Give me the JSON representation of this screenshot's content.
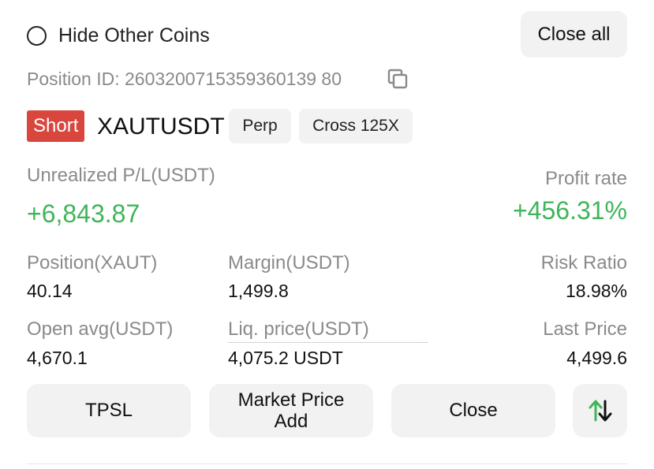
{
  "header": {
    "hide_other_coins_label": "Hide Other Coins",
    "close_all_label": "Close all"
  },
  "position": {
    "id_text": "Position ID: 2603200715359360139 80",
    "side": "Short",
    "symbol": "XAUTUSDT",
    "type_chip": "Perp",
    "margin_chip": "Cross 125X"
  },
  "pnl": {
    "unrealized_label": "Unrealized P/L(USDT)",
    "unrealized_value": "+6,843.87",
    "profit_rate_label": "Profit rate",
    "profit_rate_value": "+456.31%"
  },
  "stats": {
    "position_label": "Position(XAUT)",
    "position_value": "40.14",
    "margin_label": "Margin(USDT)",
    "margin_value": "1,499.8",
    "risk_label": "Risk Ratio",
    "risk_value": "18.98%",
    "open_avg_label": "Open avg(USDT)",
    "open_avg_value": "4,670.1",
    "liq_label": "Liq. price(USDT)",
    "liq_value": "4,075.2 USDT",
    "last_label": "Last Price",
    "last_value": "4,499.6"
  },
  "actions": {
    "tpsl": "TPSL",
    "market_add_line1": "Market Price",
    "market_add_line2": "Add",
    "close": "Close"
  },
  "colors": {
    "profit_green": "#3fb55a",
    "short_red": "#d9463e",
    "muted_gray": "#8a8a8a",
    "button_bg": "#f2f2f2"
  },
  "icons": {
    "copy": "copy-icon",
    "swap": "swap-arrows-icon",
    "radio": "radio-unchecked-icon"
  }
}
